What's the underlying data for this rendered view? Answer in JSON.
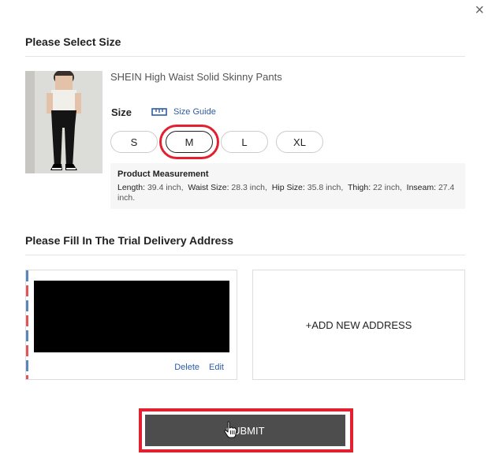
{
  "dialog": {
    "close_label": "×"
  },
  "size_section": {
    "title": "Please Select Size"
  },
  "product": {
    "name": "SHEIN High Waist Solid Skinny Pants",
    "image_icon": "product-photo-icon"
  },
  "size_picker": {
    "label": "Size",
    "guide_label": "Size Guide",
    "guide_icon": "ruler-icon",
    "options": [
      "S",
      "M",
      "L",
      "XL"
    ],
    "selected": "M"
  },
  "measurement": {
    "title": "Product Measurement",
    "items": [
      {
        "label": "Length:",
        "value": "39.4 inch,"
      },
      {
        "label": "Waist Size:",
        "value": "28.3 inch,"
      },
      {
        "label": "Hip Size:",
        "value": "35.8 inch,"
      },
      {
        "label": "Thigh:",
        "value": "22 inch,"
      },
      {
        "label": "Inseam:",
        "value": "27.4 inch."
      }
    ]
  },
  "address_section": {
    "title": "Please Fill In The Trial Delivery Address",
    "card_actions": {
      "delete": "Delete",
      "edit": "Edit"
    },
    "add_new": "+ADD NEW ADDRESS"
  },
  "submit": {
    "label": "SUBMIT"
  },
  "colors": {
    "highlight": "#e3202f",
    "link": "#2b5ca8",
    "submit_bg": "#4d4d4d"
  }
}
